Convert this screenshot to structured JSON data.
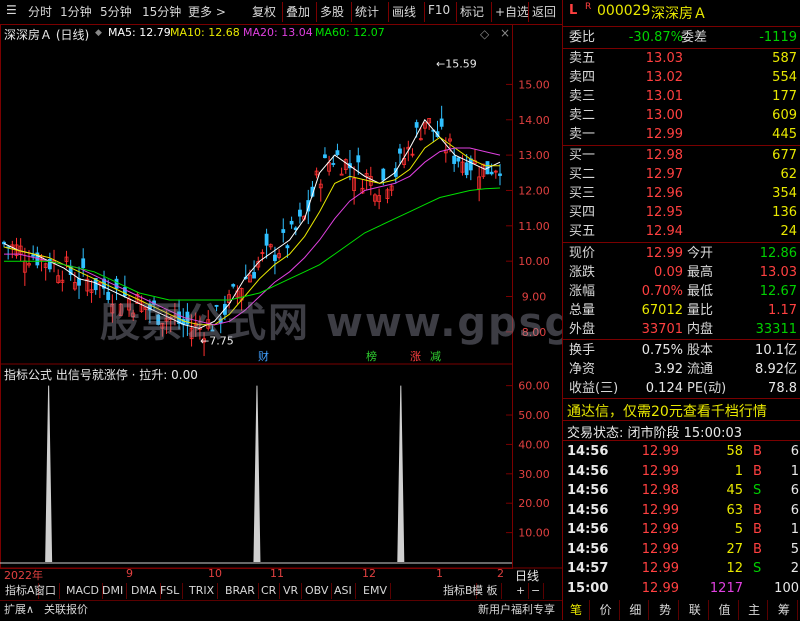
{
  "toolbar": {
    "left": [
      "分时",
      "1分钟",
      "5分钟",
      "15分钟",
      "更多 >"
    ],
    "right": [
      "复权",
      "叠加",
      "多股",
      "统计",
      "画线",
      "F10",
      "标记",
      "+自选",
      "返回"
    ]
  },
  "chart": {
    "stock_label": "深深房Ａ (日线)",
    "ma": [
      {
        "label": "MA5: 12.79",
        "color": "#ffffff"
      },
      {
        "label": "MA10: 12.68",
        "color": "#e8e800"
      },
      {
        "label": "MA20: 13.04",
        "color": "#e040e0"
      },
      {
        "label": "MA60: 12.07",
        "color": "#00e000"
      }
    ],
    "high_marker": "15.59",
    "low_marker": "7.75",
    "events": [
      "财",
      "榜",
      "涨",
      "减"
    ],
    "indicator_label": "指标公式  出信号就涨停 · 拉升: 0.00",
    "watermark": "股票公式网  www.gpsgs.com",
    "x_axis": [
      "2022年",
      "9",
      "10",
      "11",
      "12",
      "1",
      "2"
    ],
    "period": "日线"
  },
  "chart_data": [
    {
      "type": "line",
      "title": "深深房Ａ (日线)",
      "y_ticks": [
        8.0,
        9.0,
        10.0,
        11.0,
        12.0,
        13.0,
        14.0,
        15.0
      ],
      "ylim": [
        7.6,
        16.2
      ],
      "series": [
        {
          "name": "MA5",
          "values": [
            10.5,
            10.3,
            10.2,
            10.0,
            9.8,
            9.5,
            9.4,
            9.2,
            9.0,
            8.8,
            8.6,
            8.4,
            8.2,
            8.1,
            8.3,
            8.8,
            9.5,
            10.0,
            10.3,
            10.6,
            11.2,
            12.5,
            13.0,
            12.7,
            12.4,
            12.2,
            12.5,
            13.2,
            14.0,
            13.5,
            13.0,
            12.8,
            12.6,
            12.8
          ]
        },
        {
          "name": "MA10",
          "values": [
            10.4,
            10.3,
            10.2,
            10.1,
            9.9,
            9.7,
            9.5,
            9.3,
            9.1,
            8.9,
            8.7,
            8.5,
            8.3,
            8.2,
            8.2,
            8.5,
            9.0,
            9.5,
            9.9,
            10.2,
            10.7,
            11.4,
            12.2,
            12.4,
            12.3,
            12.2,
            12.3,
            12.6,
            13.2,
            13.5,
            13.2,
            12.9,
            12.7,
            12.7
          ]
        },
        {
          "name": "MA20",
          "values": [
            10.2,
            10.2,
            10.1,
            10.0,
            9.9,
            9.8,
            9.6,
            9.4,
            9.2,
            9.0,
            8.8,
            8.6,
            8.4,
            8.3,
            8.2,
            8.3,
            8.6,
            9.0,
            9.4,
            9.7,
            10.1,
            10.6,
            11.2,
            11.7,
            12.0,
            12.1,
            12.2,
            12.4,
            12.8,
            13.1,
            13.2,
            13.2,
            13.1,
            13.0
          ]
        },
        {
          "name": "MA60",
          "values": [
            10.0,
            10.0,
            10.0,
            10.0,
            9.9,
            9.8,
            9.7,
            9.5,
            9.3,
            9.1,
            9.0,
            8.9,
            8.9,
            8.9,
            8.9,
            8.9,
            9.0,
            9.1,
            9.3,
            9.5,
            9.7,
            9.9,
            10.2,
            10.5,
            10.8,
            11.0,
            11.2,
            11.4,
            11.6,
            11.8,
            11.9,
            12.0,
            12.05,
            12.07
          ]
        }
      ]
    },
    {
      "type": "bar",
      "title": "出信号就涨停",
      "y_ticks": [
        10.0,
        20.0,
        30.0,
        40.0,
        50.0,
        60.0
      ],
      "ylim": [
        0,
        66
      ],
      "signals_at_fraction": [
        0.09,
        0.51,
        0.8
      ],
      "signal_value": 60
    }
  ],
  "panel": {
    "flag": "L",
    "code": "000029",
    "name": "深深房Ａ",
    "weibi": {
      "label": "委比",
      "value": "-30.87%",
      "label2": "委差",
      "value2": "-1119"
    },
    "asks": [
      {
        "label": "卖五",
        "price": "13.03",
        "vol": "587"
      },
      {
        "label": "卖四",
        "price": "13.02",
        "vol": "554"
      },
      {
        "label": "卖三",
        "price": "13.01",
        "vol": "177"
      },
      {
        "label": "卖二",
        "price": "13.00",
        "vol": "609"
      },
      {
        "label": "卖一",
        "price": "12.99",
        "vol": "445"
      }
    ],
    "bids": [
      {
        "label": "买一",
        "price": "12.98",
        "vol": "677"
      },
      {
        "label": "买二",
        "price": "12.97",
        "vol": "62"
      },
      {
        "label": "买三",
        "price": "12.96",
        "vol": "354"
      },
      {
        "label": "买四",
        "price": "12.95",
        "vol": "136"
      },
      {
        "label": "买五",
        "price": "12.94",
        "vol": "24"
      }
    ],
    "quote": [
      {
        "l1": "现价",
        "v1": "12.99",
        "c1": "red",
        "l2": "今开",
        "v2": "12.86",
        "c2": "green"
      },
      {
        "l1": "涨跌",
        "v1": "0.09",
        "c1": "red",
        "l2": "最高",
        "v2": "13.03",
        "c2": "red"
      },
      {
        "l1": "涨幅",
        "v1": "0.70%",
        "c1": "red",
        "l2": "最低",
        "v2": "12.67",
        "c2": "green"
      },
      {
        "l1": "总量",
        "v1": "67012",
        "c1": "yellow",
        "l2": "量比",
        "v2": "1.17",
        "c2": "red"
      },
      {
        "l1": "外盘",
        "v1": "33701",
        "c1": "red",
        "l2": "内盘",
        "v2": "33311",
        "c2": "green"
      }
    ],
    "stats": [
      {
        "l1": "换手",
        "v1": "0.75%",
        "l2": "股本",
        "v2": "10.1亿"
      },
      {
        "l1": "净资",
        "v1": "3.92",
        "l2": "流通",
        "v2": "8.92亿"
      },
      {
        "l1": "收益(三)",
        "v1": "0.124",
        "l2": "PE(动)",
        "v2": "78.8"
      }
    ],
    "promo": "通达信，仅需20元查看千档行情",
    "trade_status": "交易状态: 闭市阶段  15:00:03",
    "ticks": [
      {
        "t": "14:56",
        "p": "12.99",
        "v": "58",
        "d": "B",
        "n": "6"
      },
      {
        "t": "14:56",
        "p": "12.99",
        "v": "1",
        "d": "B",
        "n": "1"
      },
      {
        "t": "14:56",
        "p": "12.98",
        "v": "45",
        "d": "S",
        "n": "6"
      },
      {
        "t": "14:56",
        "p": "12.99",
        "v": "63",
        "d": "B",
        "n": "6"
      },
      {
        "t": "14:56",
        "p": "12.99",
        "v": "5",
        "d": "B",
        "n": "1"
      },
      {
        "t": "14:56",
        "p": "12.99",
        "v": "27",
        "d": "B",
        "n": "5"
      },
      {
        "t": "14:57",
        "p": "12.99",
        "v": "12",
        "d": "S",
        "n": "2"
      },
      {
        "t": "15:00",
        "p": "12.99",
        "v": "1217",
        "d": "",
        "n": "100"
      }
    ],
    "bottom_tabs": [
      "笔",
      "价",
      "细",
      "势",
      "联",
      "值",
      "主",
      "筹"
    ]
  },
  "bottom": {
    "tabs": [
      "指标A",
      "窗口",
      "MACD",
      "DMI",
      "DMA",
      "FSL",
      "TRIX",
      "BRAR",
      "CR",
      "VR",
      "OBV",
      "ASI",
      "EMV",
      "指标B",
      "模 板",
      "+",
      "−"
    ],
    "status_left": [
      "扩展∧",
      "关联报价"
    ],
    "status_right": "新用户福利专享"
  }
}
